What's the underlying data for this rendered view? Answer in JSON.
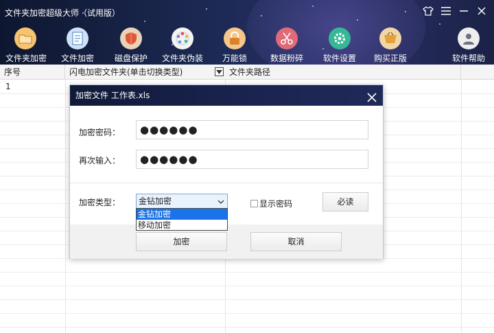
{
  "app": {
    "title": "文件夹加密超级大师（试用版）"
  },
  "window_controls": {
    "skin_icon": "shirt-icon",
    "menu_icon": "hamburger-icon",
    "minimize_icon": "minimize-icon",
    "close_icon": "close-icon"
  },
  "toolbar": {
    "items": [
      {
        "label": "文件夹加密",
        "icon": "folder-lock-icon",
        "color": "#f2a641"
      },
      {
        "label": "文件加密",
        "icon": "file-lock-icon",
        "color": "#5aa0e0"
      },
      {
        "label": "磁盘保护",
        "icon": "shield-icon",
        "color": "#e05a43"
      },
      {
        "label": "文件夹伪装",
        "icon": "disguise-icon",
        "color": "#f0f0f0"
      },
      {
        "label": "万能锁",
        "icon": "padlock-icon",
        "color": "#f29b3c"
      },
      {
        "label": "数据粉碎",
        "icon": "scissors-icon",
        "color": "#e04a5a"
      },
      {
        "label": "软件设置",
        "icon": "gear-icon",
        "color": "#35b89a"
      },
      {
        "label": "购买正版",
        "icon": "cart-icon",
        "color": "#f2b54a"
      },
      {
        "label": "软件帮助",
        "icon": "user-help-icon",
        "color": "#e9e9e9"
      }
    ]
  },
  "table": {
    "columns": [
      "序号",
      "闪电加密文件夹(单击切换类型)",
      "文件夹路径"
    ],
    "rows": [
      {
        "index": "1"
      }
    ]
  },
  "dialog": {
    "title": "加密文件  工作表.xls",
    "password_label": "加密密码：",
    "password_value": "●●●●●●",
    "confirm_label": "再次输入：",
    "confirm_value": "●●●●●●",
    "type_label": "加密类型：",
    "type_selected": "金钻加密",
    "type_options": [
      "金钻加密",
      "移动加密"
    ],
    "show_password_label": "显示密码",
    "show_password_checked": false,
    "must_read_label": "必读",
    "encrypt_label": "加密",
    "cancel_label": "取消"
  }
}
